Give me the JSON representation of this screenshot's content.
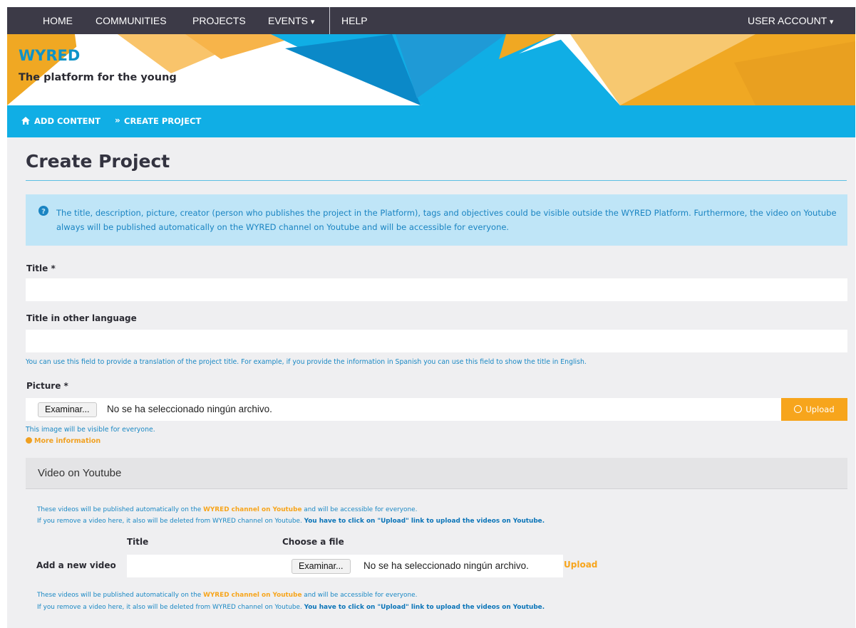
{
  "nav": {
    "items": [
      "HOME",
      "COMMUNITIES",
      "PROJECTS",
      "EVENTS",
      "HELP"
    ],
    "events_caret": "▾",
    "user_account": "USER ACCOUNT",
    "user_caret": "▾"
  },
  "brand": {
    "title": "WYRED",
    "subtitle": "The platform for the young"
  },
  "breadcrumb": {
    "home_icon": "home-icon",
    "items": [
      "ADD CONTENT",
      "CREATE PROJECT"
    ],
    "separator": "»"
  },
  "page": {
    "title": "Create Project"
  },
  "info": {
    "icon": "question-circle-icon",
    "text": "The title, description, picture, creator (person who publishes the project in the Platform), tags and objectives could be visible outside the WYRED Platform. Furthermore, the video on Youtube always will be published automatically on the WYRED channel on Youtube and will be accessible for everyone."
  },
  "form": {
    "title_label": "Title *",
    "title_value": "",
    "title_other_label": "Title in other language",
    "title_other_value": "",
    "title_other_help": "You can use this field to provide a translation of the project title. For example, if you provide the information in Spanish you can use this field to show the title in English.",
    "picture_label": "Picture *",
    "browse_label": "Examinar...",
    "file_status": "No se ha seleccionado ningún archivo.",
    "upload_label": "Upload",
    "upload_icon": "upload-circle-icon",
    "picture_help": "This image will be visible for everyone.",
    "more_info": "More information",
    "more_info_icon": "question-circle-icon"
  },
  "video": {
    "header": "Video on Youtube",
    "note_before_link": "These videos will be published automatically on the ",
    "note_link": "WYRED channel on Youtube",
    "note_after_link": " and will be accessible for everyone.",
    "note_line2": "If you remove a video here, it also will be deleted from WYRED channel on Youtube. ",
    "note_line2_strong": "You have to click on \"Upload\" link to upload the videos on Youtube.",
    "col_title": "Title",
    "col_file": "Choose a file",
    "add_label": "Add a new video",
    "browse_label": "Examinar...",
    "file_status": "No se ha seleccionado ningún archivo.",
    "upload_link": "Upload"
  },
  "colors": {
    "nav_bg": "#3c3a47",
    "accent_blue": "#10aee5",
    "accent_orange": "#f7a51c",
    "info_bg": "#bfe5f7",
    "panel_bg": "#efeff1"
  }
}
